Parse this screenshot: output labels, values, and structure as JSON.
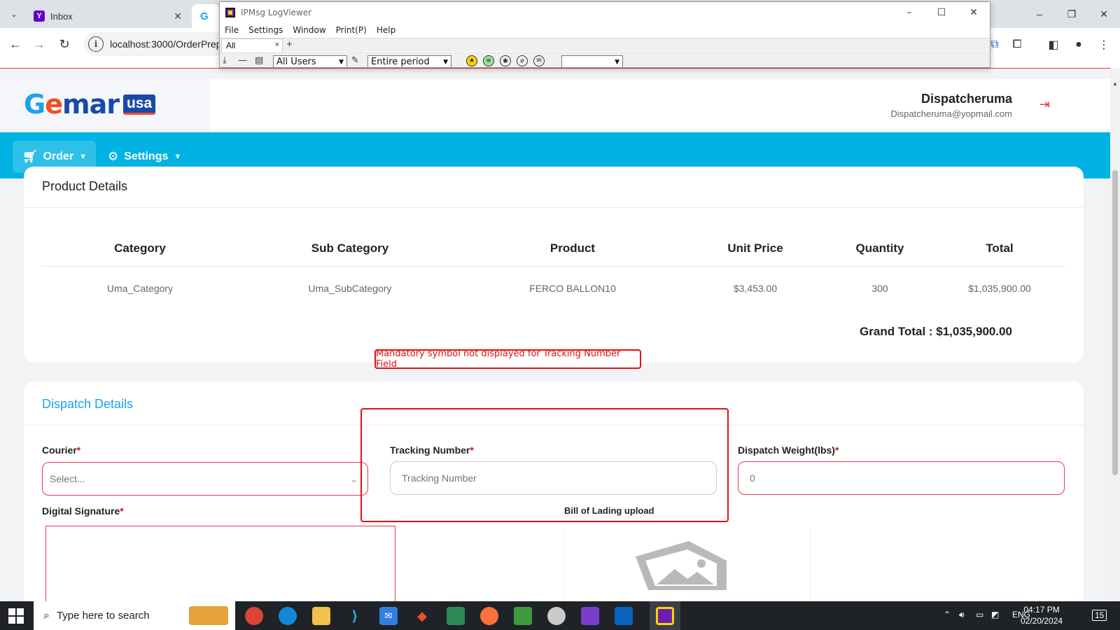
{
  "browser": {
    "tabs": [
      {
        "title": "Inbox",
        "favicon": "Y"
      },
      {
        "title": "",
        "favicon": "G"
      }
    ],
    "url": "localhost:3000/OrderPrep",
    "window_controls": {
      "minimize": "–",
      "restore": "❐",
      "close": "✕"
    }
  },
  "ipmsg": {
    "title": "IPMsg LogViewer",
    "menu": [
      "File",
      "Settings",
      "Window",
      "Print(P)",
      "Help"
    ],
    "tab": "All",
    "tab_close": "×",
    "add_tab": "+",
    "users_filter": "All Users",
    "period_filter": "Entire period",
    "empty_filter": "",
    "controls": {
      "minimize": "–",
      "maximize": "☐",
      "close": "✕"
    }
  },
  "app": {
    "logo": {
      "g": "G",
      "e": "e",
      "mar": "mar",
      "badge": "usa"
    },
    "user": {
      "name": "Dispatcheruma",
      "email": "Dispatcheruma@yopmail.com"
    },
    "nav": [
      {
        "label": "Order"
      },
      {
        "label": "Settings"
      }
    ]
  },
  "product_details": {
    "title": "Product Details",
    "columns": [
      "Category",
      "Sub Category",
      "Product",
      "Unit Price",
      "Quantity",
      "Total"
    ],
    "rows": [
      [
        "Uma_Category",
        "Uma_SubCategory",
        "FERCO BALLON10",
        "$3,453.00",
        "300",
        "$1,035,900.00"
      ]
    ],
    "grand_total": "Grand Total : $1,035,900.00"
  },
  "annotation": {
    "note": "Mandatory symbol not displayed for Tracking Number Field",
    "color": "#e01010"
  },
  "dispatch_details": {
    "title": "Dispatch Details",
    "courier": {
      "label": "Courier",
      "placeholder": "Select..."
    },
    "tracking": {
      "label": "Tracking Number",
      "placeholder": "Tracking Number"
    },
    "weight": {
      "label": "Dispatch Weight(lbs)",
      "value": "0"
    },
    "signature": {
      "label": "Digital Signature"
    },
    "bol": {
      "label": "Bill of Lading upload"
    },
    "required_mark": "*"
  },
  "taskbar": {
    "search_placeholder": "Type here to search",
    "language": "ENG",
    "time": "04:17 PM",
    "date": "02/20/2024",
    "notifications": "15"
  },
  "colors": {
    "brand_blue": "#00b3e3",
    "accent_red": "#e63950",
    "link_blue": "#1aa3e8"
  }
}
